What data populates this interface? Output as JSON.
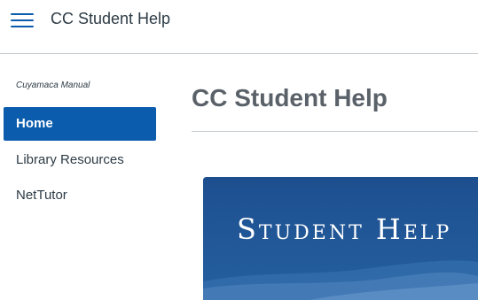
{
  "header": {
    "menu_icon": "hamburger-menu-icon",
    "title": "CC Student Help"
  },
  "sidebar": {
    "course_name": "Cuyamaca Manual",
    "items": [
      {
        "label": "Home",
        "active": true
      },
      {
        "label": "Library Resources",
        "active": false
      },
      {
        "label": "NetTutor",
        "active": false
      }
    ]
  },
  "main": {
    "page_title": "CC Student Help",
    "banner": {
      "text": "Student Help",
      "background_color": "#1d4f8f"
    }
  },
  "colors": {
    "accent": "#0b5cad",
    "text": "#2d3b45"
  }
}
